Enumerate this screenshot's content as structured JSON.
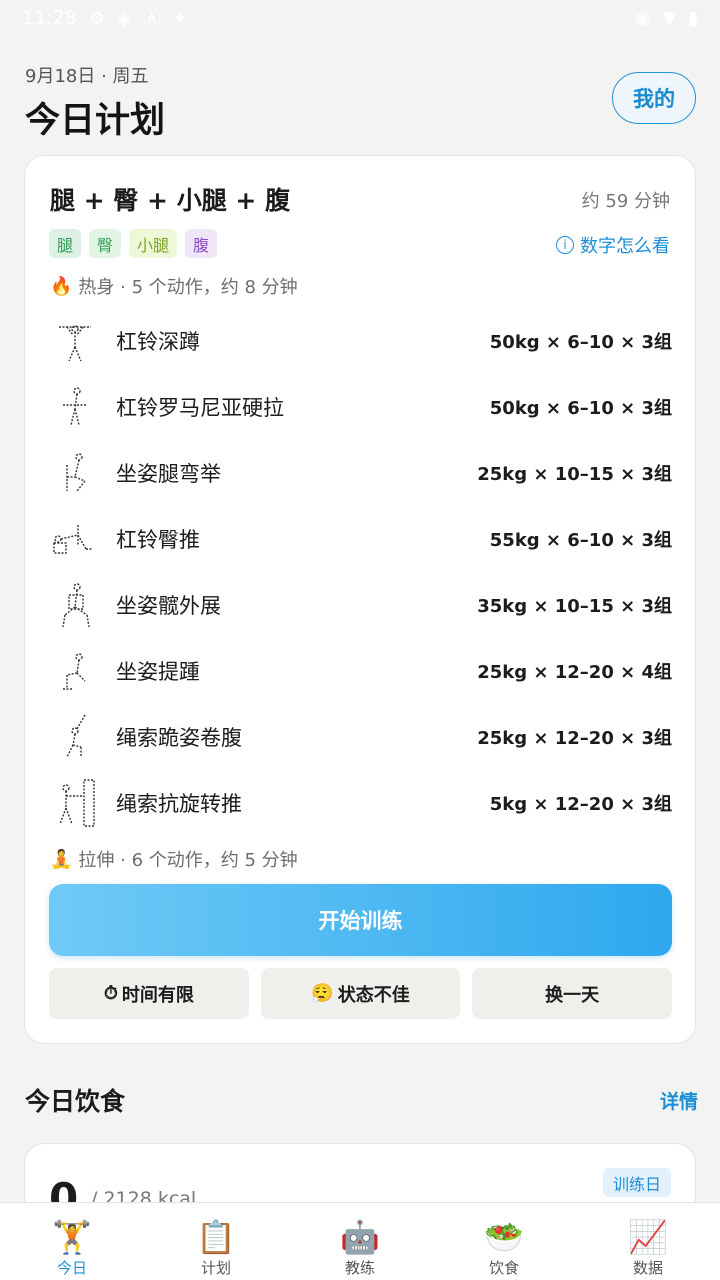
{
  "status_bar": {
    "time": "11:28",
    "icons_left": [
      "gear-icon",
      "network-icon",
      "a-icon",
      "bug-icon"
    ],
    "icons_right": [
      "location-icon",
      "wifi-icon",
      "battery-icon"
    ]
  },
  "header": {
    "date": "9月18日 · 周五",
    "title": "今日计划",
    "me_button": "我的"
  },
  "workout": {
    "title": "腿 + 臀 + 小腿 + 腹",
    "duration": "约 59 分钟",
    "tags": [
      "腿",
      "臀",
      "小腿",
      "腹"
    ],
    "howto_link": "数字怎么看",
    "warmup": "热身 · 5 个动作，约 8 分钟",
    "stretch": "拉伸 · 6 个动作，约 5 分钟",
    "exercises": [
      {
        "name": "杠铃深蹲",
        "spec": "50kg × 6–10 × 3组"
      },
      {
        "name": "杠铃罗马尼亚硬拉",
        "spec": "50kg × 6–10 × 3组"
      },
      {
        "name": "坐姿腿弯举",
        "spec": "25kg × 10–15 × 3组"
      },
      {
        "name": "杠铃臀推",
        "spec": "55kg × 6–10 × 3组"
      },
      {
        "name": "坐姿髋外展",
        "spec": "35kg × 10–15 × 3组"
      },
      {
        "name": "坐姿提踵",
        "spec": "25kg × 12–20 × 4组"
      },
      {
        "name": "绳索跪姿卷腹",
        "spec": "25kg × 12–20 × 3组"
      },
      {
        "name": "绳索抗旋转推",
        "spec": "5kg × 12–20 × 3组"
      }
    ],
    "start_button": "开始训练",
    "sub_buttons": {
      "limited_time": "时间有限",
      "not_feeling_well": "状态不佳",
      "swap_day": "换一天"
    }
  },
  "diet": {
    "title": "今日饮食",
    "detail_link": "详情",
    "kcal_value": "0",
    "kcal_goal": "/ 2128 kcal",
    "badge": "训练日"
  },
  "bottom_nav": [
    {
      "label": "今日",
      "icon": "weightlifter-icon",
      "glyph": "🏋️",
      "active": true
    },
    {
      "label": "计划",
      "icon": "clipboard-icon",
      "glyph": "📋",
      "active": false
    },
    {
      "label": "教练",
      "icon": "robot-icon",
      "glyph": "🤖",
      "active": false
    },
    {
      "label": "饮食",
      "icon": "salad-icon",
      "glyph": "🥗",
      "active": false
    },
    {
      "label": "数据",
      "icon": "chart-icon",
      "glyph": "📈",
      "active": false
    }
  ],
  "colors": {
    "accent": "#1d8fd6",
    "start_gradient_from": "#6fcaf6",
    "start_gradient_to": "#2ea8ee",
    "background": "#f3f3f1"
  }
}
